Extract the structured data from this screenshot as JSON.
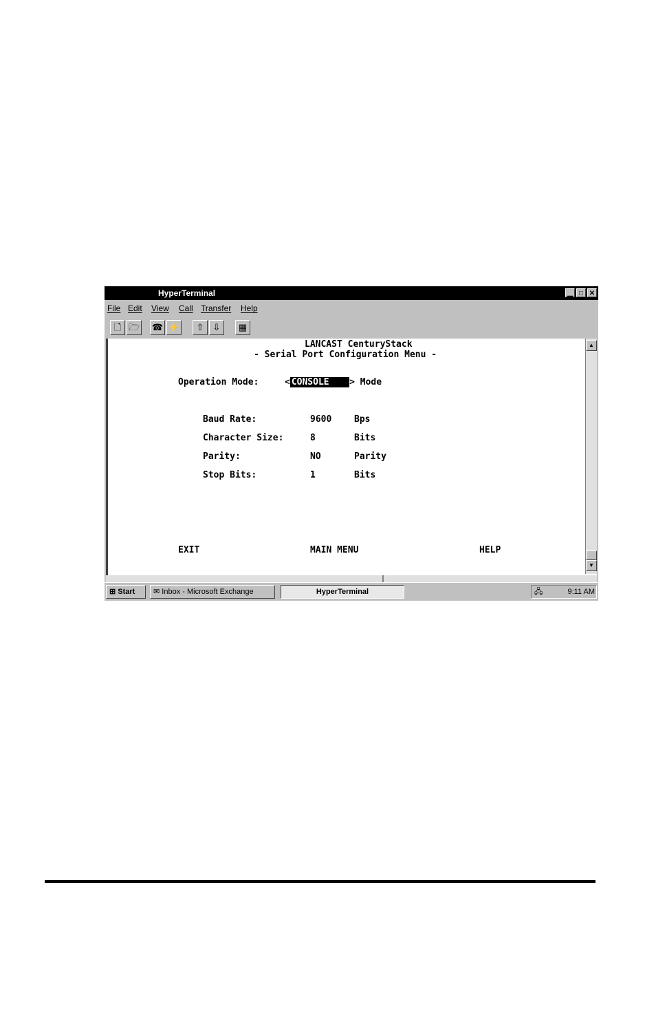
{
  "window": {
    "title": "HyperTerminal",
    "controls": {
      "minimize": "▁",
      "maximize": "□",
      "close": "✕"
    }
  },
  "menu": [
    "File",
    "Edit",
    "View",
    "Call",
    "Transfer",
    "Help"
  ],
  "toolbar_icons": [
    "new-icon",
    "open-icon",
    "phone-icon",
    "disconnect-icon",
    "send-icon",
    "receive-icon",
    "properties-icon"
  ],
  "terminal": {
    "heading1": "LANCAST CenturyStack",
    "heading2": "- Serial Port Configuration Menu -",
    "operation_mode": {
      "label": "Operation Mode:",
      "open": "<",
      "value": "CONSOLE",
      "close": "> Mode"
    },
    "settings": [
      {
        "label": "Baud Rate:",
        "value": "9600",
        "unit": "Bps"
      },
      {
        "label": "Character Size:",
        "value": "8",
        "unit": "Bits"
      },
      {
        "label": "Parity:",
        "value": "NO",
        "unit": "Parity"
      },
      {
        "label": "Stop Bits:",
        "value": "1",
        "unit": "Bits"
      }
    ],
    "actions": {
      "exit": "EXIT",
      "main_menu": "MAIN MENU",
      "help": "HELP"
    }
  },
  "taskbar": {
    "start": "Start",
    "inbox": "Inbox - Microsoft Exchange",
    "active": "HyperTerminal",
    "clock": "9:11 AM"
  }
}
